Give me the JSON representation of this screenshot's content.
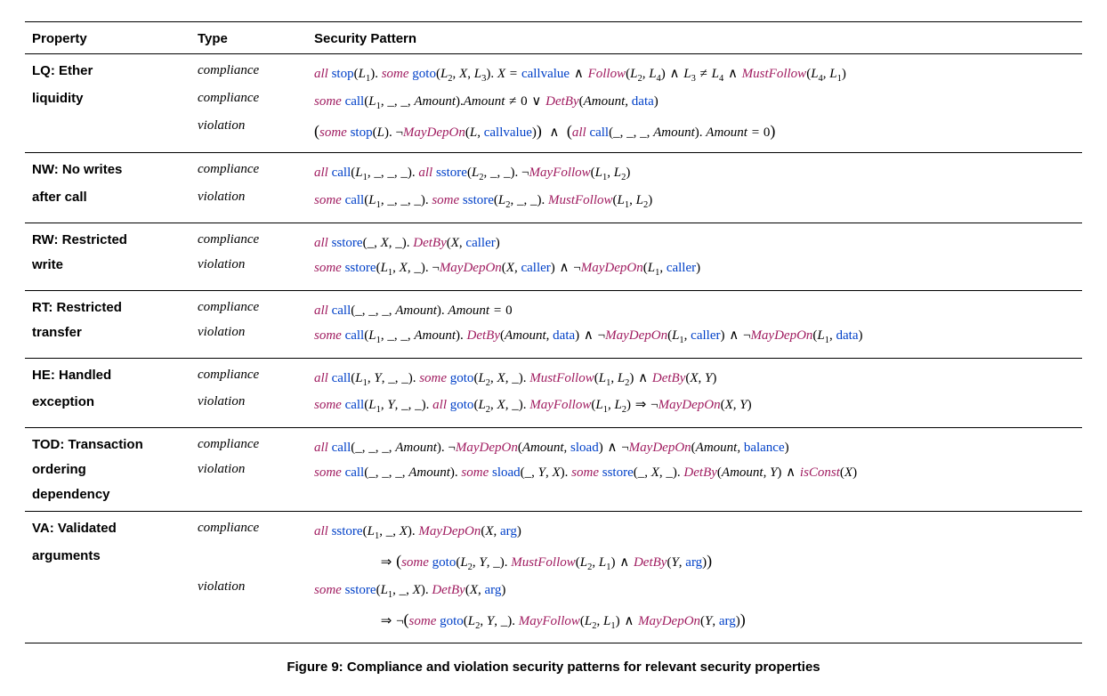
{
  "caption": "Figure 9: Compliance and violation security patterns for relevant security properties",
  "header": {
    "c1": "Property",
    "c2": "Type",
    "c3": "Security Pattern"
  },
  "chart_data": {
    "type": "table",
    "columns": [
      "Property",
      "Type",
      "Security Pattern"
    ],
    "rows": [
      [
        "LQ: Ether liquidity",
        "compliance",
        "all stop(L1). some goto(L2, X, L3). X = callvalue ∧ Follow(L2, L4) ∧ L3 ≠ L4 ∧ MustFollow(L4, L1)"
      ],
      [
        "",
        "compliance",
        "some call(L1, _, _, Amount). Amount ≠ 0 ∨ DetBy(Amount, data)"
      ],
      [
        "",
        "violation",
        "(some stop(L). ¬MayDepOn(L, callvalue)) ∧ (all call(_, _, _, Amount). Amount = 0)"
      ],
      [
        "NW: No writes after call",
        "compliance",
        "all call(L1, _, _, _). all sstore(L2, _, _). ¬MayFollow(L1, L2)"
      ],
      [
        "",
        "violation",
        "some call(L1, _, _, _). some sstore(L2, _, _). MustFollow(L1, L2)"
      ],
      [
        "RW: Restricted write",
        "compliance",
        "all sstore(_, X, _). DetBy(X, caller)"
      ],
      [
        "",
        "violation",
        "some sstore(L1, X, _). ¬MayDepOn(X, caller) ∧ ¬MayDepOn(L1, caller)"
      ],
      [
        "RT: Restricted transfer",
        "compliance",
        "all call(_, _, _, Amount). Amount = 0"
      ],
      [
        "",
        "violation",
        "some call(L1, _, _, Amount). DetBy(Amount, data) ∧ ¬MayDepOn(L1, caller) ∧ ¬MayDepOn(L1, data)"
      ],
      [
        "HE: Handled exception",
        "compliance",
        "all call(L1, Y, _, _). some goto(L2, X, _). MustFollow(L1, L2) ∧ DetBy(X, Y)"
      ],
      [
        "",
        "violation",
        "some call(L1, Y, _, _). all goto(L2, X, _). MayFollow(L1, L2) ⇒ ¬MayDepOn(X, Y)"
      ],
      [
        "TOD: Transaction ordering dependency",
        "compliance",
        "all call(_, _, _, Amount). ¬MayDepOn(Amount, sload) ∧ ¬MayDepOn(Amount, balance)"
      ],
      [
        "",
        "violation",
        "some call(_, _, _, Amount). some sload(_, Y, X). some sstore(_, X, _). DetBy(Amount, Y) ∧ isConst(X)"
      ],
      [
        "VA: Validated arguments",
        "compliance",
        "all sstore(L1, _, X). MayDepOn(X, arg) ⇒ (some goto(L2, Y, _). MustFollow(L2, L1) ∧ DetBy(Y, arg))"
      ],
      [
        "",
        "violation",
        "some sstore(L1, _, X). DetBy(X, arg) ⇒ ¬(some goto(L2, Y, _). MayFollow(L2, L1) ∧ MayDepOn(Y, arg))"
      ]
    ]
  },
  "tok": {
    "all": "all",
    "some": "some",
    "stop": "stop",
    "goto": "goto",
    "call": "call",
    "sstore": "sstore",
    "sload": "sload",
    "callvalue": "callvalue",
    "caller": "caller",
    "data": "data",
    "arg": "arg",
    "balance": "balance",
    "Follow": "Follow",
    "MustFollow": "MustFollow",
    "MayFollow": "MayFollow",
    "MayDepOn": "MayDepOn",
    "DetBy": "DetBy",
    "isConst": "isConst",
    "Amount": "Amount",
    "X": "X",
    "Y": "Y",
    "L": "L",
    "L1": "L",
    "L2": "L",
    "L3": "L",
    "L4": "L",
    "s1": "1",
    "s2": "2",
    "s3": "3",
    "s4": "4",
    "u": "_",
    "lp": "(",
    "rp": ")",
    "dot": ". ",
    "comma": ", ",
    "and": " ∧ ",
    "or": " ∨ ",
    "not": "¬",
    "eq": " = ",
    "neq": " ≠ ",
    "imp": " ⇒ "
  },
  "props": {
    "LQ1": "LQ: Ether",
    "LQ2": "liquidity",
    "NW1": "NW: No writes",
    "NW2": "after call",
    "RW1": "RW: Restricted",
    "RW2": "write",
    "RT1": "RT: Restricted",
    "RT2": "transfer",
    "HE1": "HE: Handled",
    "HE2": "exception",
    "TOD1": "TOD: Transaction",
    "TOD2": "ordering",
    "TOD3": "dependency",
    "VA1": "VA: Validated",
    "VA2": "arguments"
  },
  "types": {
    "comp": "compliance",
    "viol": "violation"
  }
}
